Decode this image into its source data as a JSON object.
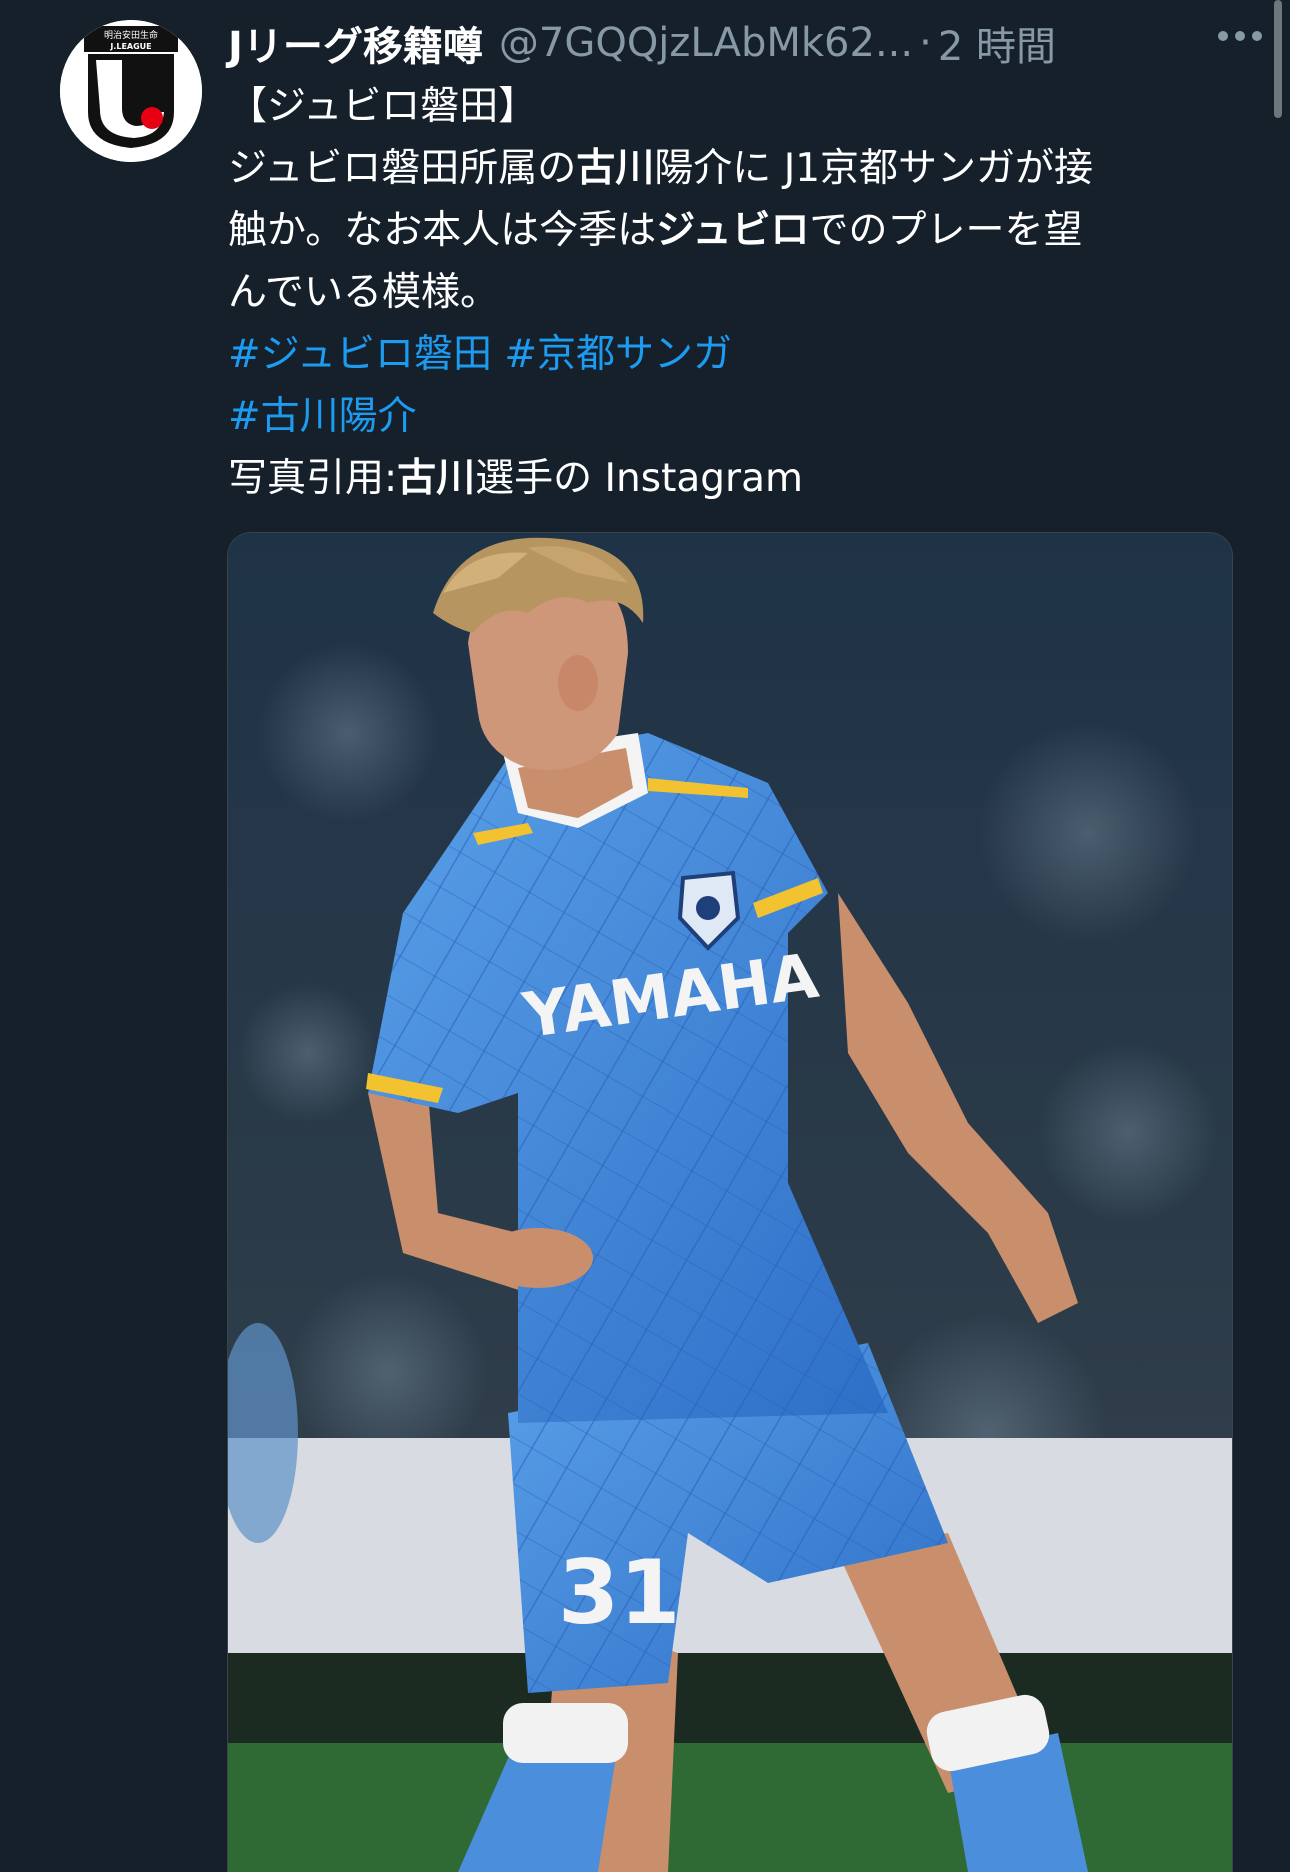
{
  "tweet": {
    "display_name": "Jリーグ移籍噂",
    "handle": "@7GQQjzLAbMk62...",
    "separator": "·",
    "time": "2 時間",
    "avatar": {
      "text": "明治安田生命 J.LEAGUE",
      "colors": {
        "red": "#e60012",
        "black": "#111111"
      }
    },
    "icons": {
      "more": "more-icon"
    },
    "body": {
      "line1": "【ジュビロ磐田】",
      "line2_a": "ジュビロ磐田所属の",
      "line2_b": "古川",
      "line2_c": "陽介に J1京都サンガが接",
      "line3_a": "触か。なお本人は今季は",
      "line3_b": "ジュビロ",
      "line3_c": "でのプレーを望",
      "line4": "んでいる模様。",
      "hashtag1": "#ジュビロ磐田",
      "hashtag2": "#京都サンガ",
      "hashtag3": "#古川陽介",
      "credit_a": "写真引用:",
      "credit_b": "古川",
      "credit_c": "選手の Instagram"
    },
    "media": {
      "jersey_sponsor": "YAMAHA",
      "jersey_number": "31"
    }
  },
  "colors": {
    "background": "#15202b",
    "text": "#ffffff",
    "muted": "#8899a6",
    "link": "#1d9bf0",
    "jersey_blue": "#4a90e2"
  }
}
